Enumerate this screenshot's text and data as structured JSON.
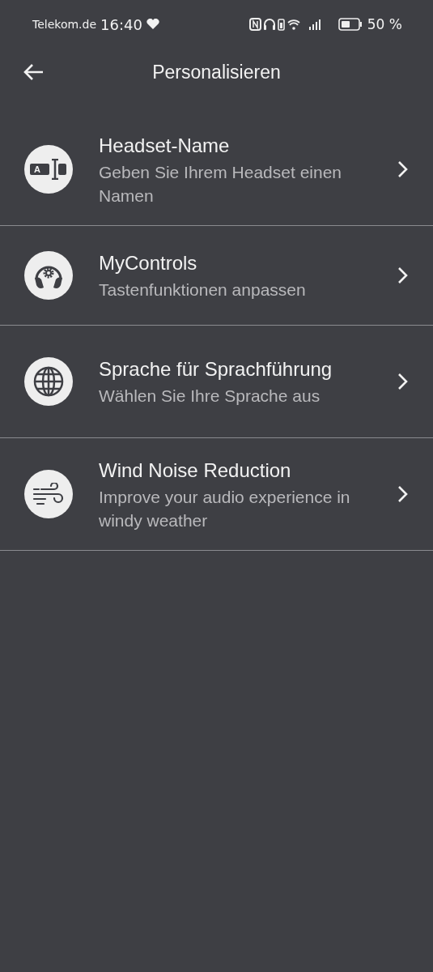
{
  "status_bar": {
    "carrier": "Telekom.de",
    "time": "16:40",
    "battery": "50 %"
  },
  "header": {
    "title": "Personalisieren"
  },
  "items": [
    {
      "kind": "rename",
      "icon_letter": "A",
      "title": "Headset-Name",
      "subtitle": "Geben Sie Ihrem Headset einen Namen"
    },
    {
      "kind": "controls",
      "title": "MyControls",
      "subtitle": "Tastenfunktionen anpassen"
    },
    {
      "kind": "language",
      "title": "Sprache für Sprachführung",
      "subtitle": "Wählen Sie Ihre Sprache aus"
    },
    {
      "kind": "wind",
      "title": "Wind Noise Reduction",
      "subtitle": "Improve your audio experience in windy weather"
    }
  ]
}
